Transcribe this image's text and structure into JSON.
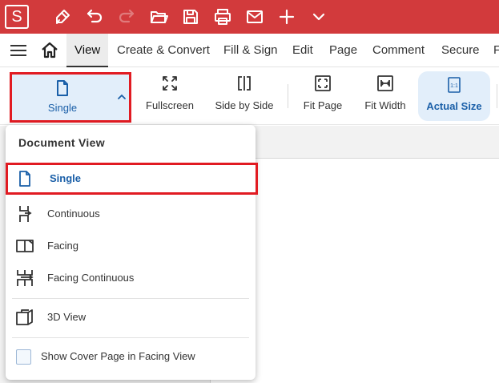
{
  "app": {
    "logo_letter": "S"
  },
  "colors": {
    "titlebar": "#d23a3c",
    "accent": "#1a5fa8",
    "highlight": "#e11b22",
    "active_bg": "#e2eefa"
  },
  "titlebar": {
    "icons": [
      "pen-icon",
      "undo-icon",
      "redo-icon",
      "open-folder-icon",
      "save-icon",
      "print-icon",
      "mail-icon",
      "plus-icon",
      "chevron-down-icon"
    ]
  },
  "menu": {
    "tabs": [
      {
        "label": "View",
        "active": true
      },
      {
        "label": "Create & Convert"
      },
      {
        "label": "Fill & Sign"
      },
      {
        "label": "Edit"
      },
      {
        "label": "Page"
      },
      {
        "label": "Comment"
      },
      {
        "label": "Secure"
      },
      {
        "label": "F"
      }
    ]
  },
  "ribbon": {
    "single": "Single",
    "fullscreen": "Fullscreen",
    "side_by_side": "Side by Side",
    "fit_page": "Fit Page",
    "fit_width": "Fit Width",
    "actual_size": "Actual Size",
    "actual_size_icon_text": "1:1"
  },
  "dropdown": {
    "header": "Document View",
    "items": [
      {
        "label": "Single",
        "icon": "single-page-icon",
        "selected": true
      },
      {
        "label": "Continuous",
        "icon": "continuous-icon"
      },
      {
        "label": "Facing",
        "icon": "facing-icon"
      },
      {
        "label": "Facing Continuous",
        "icon": "facing-continuous-icon"
      },
      {
        "label": "3D View",
        "icon": "3d-view-icon"
      }
    ],
    "checkbox_label": "Show Cover Page in Facing View",
    "checkbox_checked": false
  }
}
